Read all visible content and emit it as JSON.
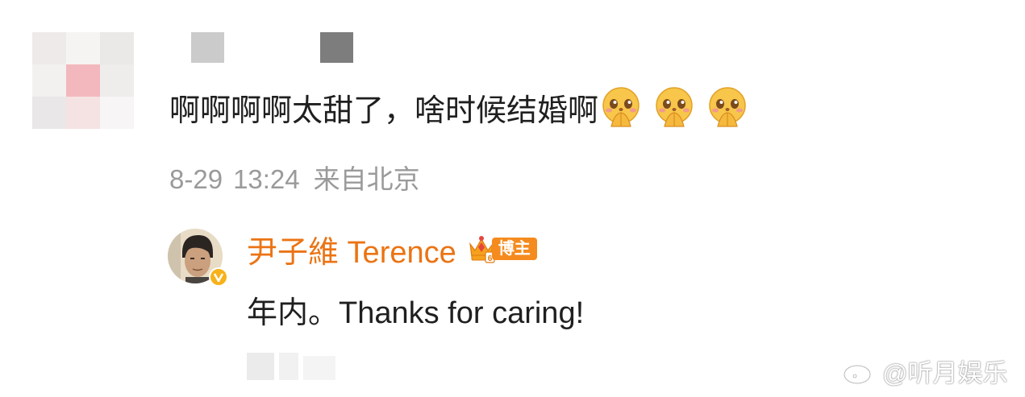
{
  "comment": {
    "text": "啊啊啊啊太甜了，啥时候结婚啊",
    "emojis": [
      "praying-emoji",
      "praying-emoji",
      "praying-emoji"
    ],
    "date": "8-29",
    "time": "13:24",
    "location": "来自北京"
  },
  "reply": {
    "author_name": "尹子維 Terence",
    "author_tag": "博主",
    "text": "年内。Thanks for caring!"
  },
  "watermark": {
    "text": "@听月娱乐"
  },
  "colors": {
    "author_name": "#eb7414",
    "tag_bg": "#f58b1e",
    "meta_text": "#9a9a9a",
    "body_text": "#1f1f1f"
  }
}
